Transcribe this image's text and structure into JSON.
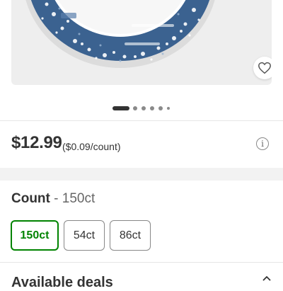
{
  "product": {
    "favorite_icon": "heart-outline-icon",
    "image_count": 6,
    "active_image_index": 0
  },
  "price": {
    "amount": "$12.99",
    "unit": "($0.09/count)",
    "info_icon": "info-circle-icon",
    "info_glyph": "i"
  },
  "variant": {
    "label": "Count",
    "separator": " - ",
    "selected": "150ct",
    "options": [
      {
        "label": "150ct",
        "selected": true
      },
      {
        "label": "54ct",
        "selected": false
      },
      {
        "label": "86ct",
        "selected": false
      }
    ]
  },
  "deals": {
    "heading": "Available deals",
    "chevron_icon": "chevron-up-icon"
  },
  "colors": {
    "selected_green": "#008300",
    "plate_blue": "#3b6290",
    "text_dark": "#333333"
  }
}
